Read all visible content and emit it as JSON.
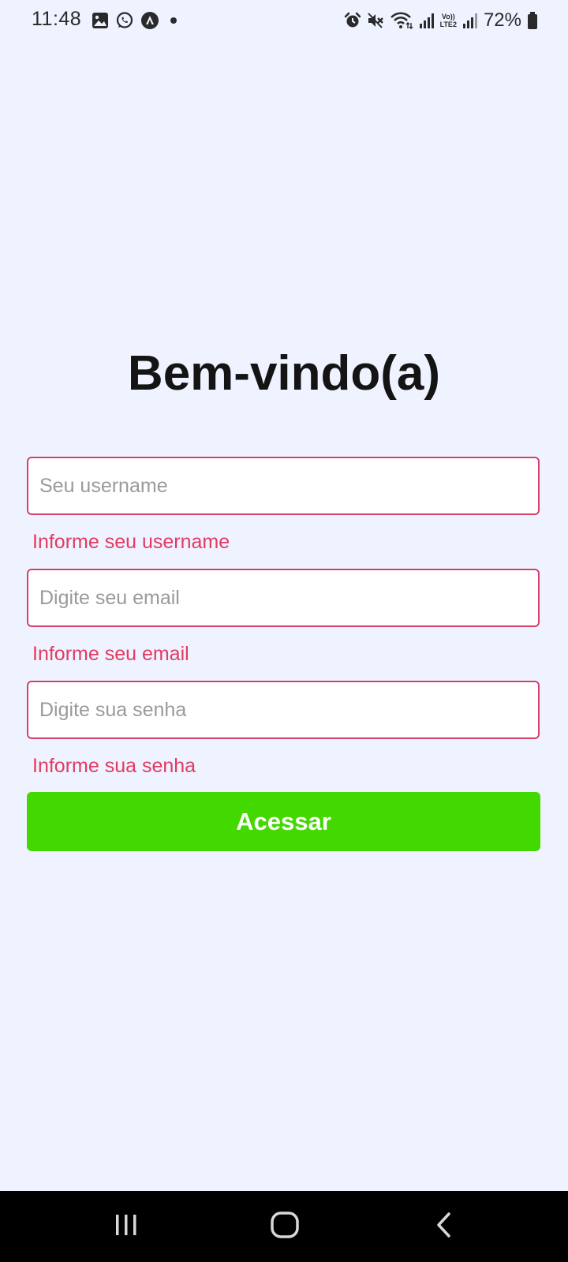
{
  "status_bar": {
    "time": "11:48",
    "battery": "72%",
    "icons": [
      "gallery-icon",
      "whatsapp-icon",
      "app-icon",
      "notification-dot",
      "alarm-icon",
      "mute-icon",
      "wifi-icon",
      "signal-icon",
      "volte-lte2-icon",
      "signal-2-icon",
      "battery-icon"
    ],
    "lte_line1": "Vo))",
    "lte_line2": "LTE2"
  },
  "login": {
    "title": "Bem-vindo(a)",
    "username": {
      "value": "",
      "placeholder": "Seu username",
      "error": "Informe seu username"
    },
    "email": {
      "value": "",
      "placeholder": "Digite seu email",
      "error": "Informe seu email"
    },
    "password": {
      "value": "",
      "placeholder": "Digite sua senha",
      "error": "Informe sua senha"
    },
    "submit_label": "Acessar"
  },
  "nav_bar": {
    "icons": [
      "recent-apps-icon",
      "home-icon",
      "back-icon"
    ]
  },
  "colors": {
    "background": "#eff3ff",
    "error": "#e23a62",
    "field_border": "#d6416c",
    "button": "#43d900",
    "nav_bar": "#000000"
  }
}
